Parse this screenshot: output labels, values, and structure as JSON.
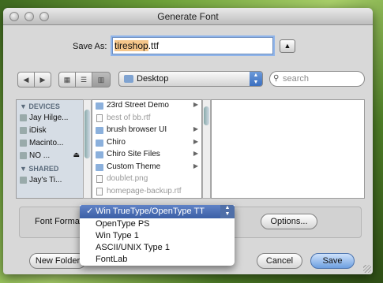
{
  "window": {
    "title": "Generate Font"
  },
  "save_as": {
    "label": "Save As:",
    "value_selected": "tireshop",
    "value_rest": ".ttf"
  },
  "toolbar": {
    "location": "Desktop",
    "search_placeholder": "search"
  },
  "sidebar": {
    "sections": [
      {
        "title": "DEVICES",
        "items": [
          "Jay Hilge...",
          "iDisk",
          "Macinto...",
          "NO ..."
        ]
      },
      {
        "title": "SHARED",
        "items": [
          "Jay's Ti..."
        ]
      }
    ]
  },
  "files": [
    {
      "name": "23rd Street Demo",
      "type": "folder"
    },
    {
      "name": "best of bb.rtf",
      "type": "file"
    },
    {
      "name": "brush browser UI",
      "type": "folder"
    },
    {
      "name": "Chiro",
      "type": "folder"
    },
    {
      "name": "Chiro Site Files",
      "type": "folder"
    },
    {
      "name": "Custom Theme",
      "type": "folder"
    },
    {
      "name": "doublet.png",
      "type": "file"
    },
    {
      "name": "homepage-backup.rtf",
      "type": "file"
    }
  ],
  "font_format": {
    "label": "Font Format",
    "options": [
      "Win TrueType/OpenType TT",
      "OpenType PS",
      "Win Type 1",
      "ASCII/UNIX Type 1",
      "FontLab"
    ],
    "selected_index": 0
  },
  "buttons": {
    "options": "Options...",
    "new_folder": "New Folder",
    "cancel": "Cancel",
    "save": "Save"
  }
}
